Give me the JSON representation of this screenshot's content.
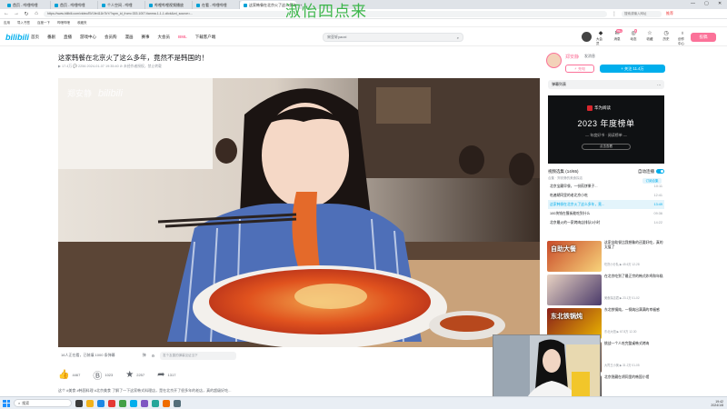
{
  "browser": {
    "tabs": [
      {
        "label": "首页 - 哔哩哔哩",
        "icon": "bilibili-icon"
      },
      {
        "label": "首页 - 哔哩哔哩",
        "icon": "bilibili-icon"
      },
      {
        "label": "个人空间 - 哔哩",
        "icon": "bilibili-icon"
      },
      {
        "label": "哔哩哔哩视频播放",
        "icon": "bilibili-icon"
      },
      {
        "label": "在看 - 哔哩哔哩",
        "icon": "bilibili-icon"
      },
      {
        "label": "这家韩餐在北京火了这么多年...",
        "icon": "bilibili-icon",
        "active": true
      }
    ],
    "url": "https://www.bilibili.com/video/BV1fe411b7kY/?spm_id_from=333.1007.tianma.1-1-1.click&vd_source=...",
    "ext_search_placeholder": "搜索或输入网址",
    "ext_tag": "推荐",
    "bookmarks": [
      "应用",
      "导入书签",
      "百度一下",
      "哔哩哔哩",
      "收藏夹"
    ]
  },
  "watermark": "淑怡四点来",
  "site": {
    "logo": "bilibili",
    "nav": [
      "首页",
      "番剧",
      "直播",
      "游戏中心",
      "会员购",
      "漫画",
      "赛事",
      "大会员",
      "BML",
      "下载客户端"
    ],
    "nav_highlight": "BML",
    "search_placeholder": "宋亚轩yaoxi",
    "top_icons": [
      {
        "label": "大会员",
        "glyph": "◆",
        "name": "vip-icon"
      },
      {
        "label": "消息",
        "glyph": "✉",
        "name": "message-icon",
        "badge": "99+"
      },
      {
        "label": "动态",
        "glyph": "◎",
        "name": "dynamic-icon",
        "badge": "8"
      },
      {
        "label": "收藏",
        "glyph": "☆",
        "name": "star-icon"
      },
      {
        "label": "历史",
        "glyph": "◷",
        "name": "history-icon"
      },
      {
        "label": "创作中心",
        "glyph": "♁",
        "name": "creator-icon"
      }
    ],
    "upload_label": "投稿"
  },
  "video": {
    "title": "这家韩餐在北京火了这么多年，竟然不是韩国的！",
    "meta": "▶ 17.4万   💬 2256   2024-01-07 19:35:40   ⊘ 未经作者授权，禁止转载",
    "danmu_count": "16人正在看，已装填 1000 条弹幕",
    "danmu_placeholder": "发个友善的弹幕见证当下",
    "danmu_ctl": "弹",
    "actions": [
      {
        "name": "like-icon",
        "glyph": "👍",
        "count": "4467"
      },
      {
        "name": "coin-icon",
        "glyph": "Ⓑ",
        "count": "1023"
      },
      {
        "name": "favorite-icon",
        "glyph": "★",
        "count": "2257"
      },
      {
        "name": "share-icon",
        "glyph": "➦",
        "count": "1317"
      }
    ],
    "tags_line": "这个 #美食 #韩国料理 #北京美食 了解了一下这家韩式料理店，是在北京开了很多年的老店，真的超级好吃...",
    "player_logo": "bilibili",
    "player_watermark": "郑安静"
  },
  "uploader": {
    "name": "郑安静",
    "send_msg": "发消息",
    "charge_label": "⚡ 充电",
    "follow_label": "+ 关注 11.4万"
  },
  "danmaku_list": {
    "label": "弹幕列表",
    "ctl": "⋯"
  },
  "ad": {
    "brand": "华为阅读",
    "headline": "2023 年度榜单",
    "subline": "— 年度好书 · 阅读榜单 —",
    "button": "点击查看"
  },
  "series": {
    "title": "视频选集 (14/65)",
    "autoplay": "自动连播",
    "subtitle": "合集 · 郑安静的美食探店",
    "subscribe": "订阅合集",
    "episodes": [
      {
        "title": "北京宝藏早餐，一份煎饼果子...",
        "dur": "10:11"
      },
      {
        "title": "吃遍胡同里的老北京小吃",
        "dur": "12:41"
      },
      {
        "title": "这家韩餐在北京火了这么多年，竟...",
        "dur": "13:49",
        "active": true
      },
      {
        "title": "100块钱在簋街能吃到什么",
        "dur": "09:36"
      },
      {
        "title": "北京最火的一家烤肉店排队3小时",
        "dur": "14:22"
      }
    ]
  },
  "recommendations": [
    {
      "title": "这家自助餐比我想象的还要好吃，真的太值了",
      "meta": "吃货小分队  ▶ 45.6万  12-28",
      "label": "自助大餐"
    },
    {
      "title": "在北京吃到了最正宗的韩式炸鸡和年糕",
      "meta": "美食探店君  ▶ 23.1万  01-02",
      "label": ""
    },
    {
      "title": "东北铁锅炖，一锅炖出满满的幸福感",
      "meta": "东北大妞  ▶ 67.8万  12-30",
      "label": "东北铁锅炖"
    },
    {
      "title": "挑战一个人吃完整桌韩式烤肉",
      "meta": "大胃王小美  ▶ 31.2万  01-05",
      "label": ""
    },
    {
      "title": "北京隐藏在胡同里的韩国小馆",
      "meta": "北漂日记  ▶ 12.9万  01-06",
      "label": ""
    }
  ],
  "taskbar": {
    "search": "搜索",
    "time": "19:42",
    "date": "2024/1/8"
  }
}
